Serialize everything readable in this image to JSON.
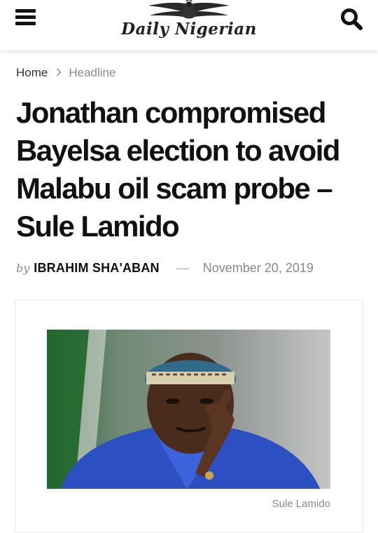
{
  "header": {
    "menu_icon": "hamburger-menu-icon",
    "logo_text": "Daily Nigerian",
    "search_icon": "search-icon"
  },
  "breadcrumb": {
    "home": "Home",
    "separator_icon": "chevron-right-icon",
    "category": "Headline"
  },
  "article": {
    "title": "Jonathan compromised Bayelsa election to avoid Malabu oil scam probe – Sule Lamido",
    "by": "by",
    "author": "IBRAHIM SHA'ABAN",
    "dash": "—",
    "date": "November 20, 2019",
    "image_caption": "Sule Lamido"
  },
  "colors": {
    "text": "#111111",
    "muted": "#8a8a8a",
    "header_bg": "#ffffff"
  }
}
